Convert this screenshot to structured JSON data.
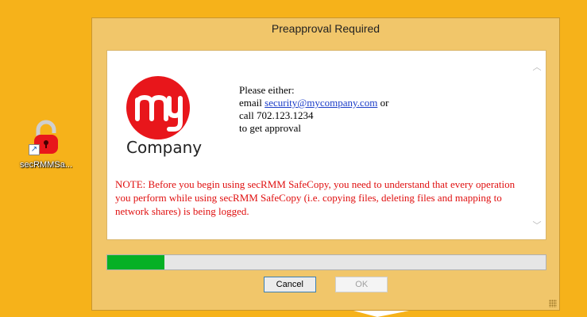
{
  "desktop": {
    "shortcut_label": "secRMMSa..."
  },
  "dialog": {
    "title": "Preapproval Required",
    "logo_text": "Company",
    "please_either": "Please either:",
    "email_prefix": "email ",
    "email": "security@mycompany.com",
    "email_suffix": " or",
    "call_line": "call 702.123.1234",
    "approval_line": "to get approval",
    "note": "NOTE:  Before you begin using secRMM SafeCopy, you need to understand that every operation you perform while using secRMM SafeCopy (i.e. copying files, deleting files and mapping to network shares) is being logged.",
    "progress_fraction": 0.13,
    "cancel_label": "Cancel",
    "ok_label": "OK"
  },
  "colors": {
    "desktop_bg": "#f6b21a",
    "logo_red": "#e8161b",
    "note_red": "#e01010",
    "progress_green": "#06b025",
    "link_blue": "#1a3cc8"
  },
  "icons": {
    "shortcut_icon": "red-padlock-icon",
    "shortcut_badge": "shortcut-arrow-icon",
    "scroll_up": "chevron-up-icon",
    "scroll_down": "chevron-down-icon",
    "resize": "resize-grip-icon"
  }
}
